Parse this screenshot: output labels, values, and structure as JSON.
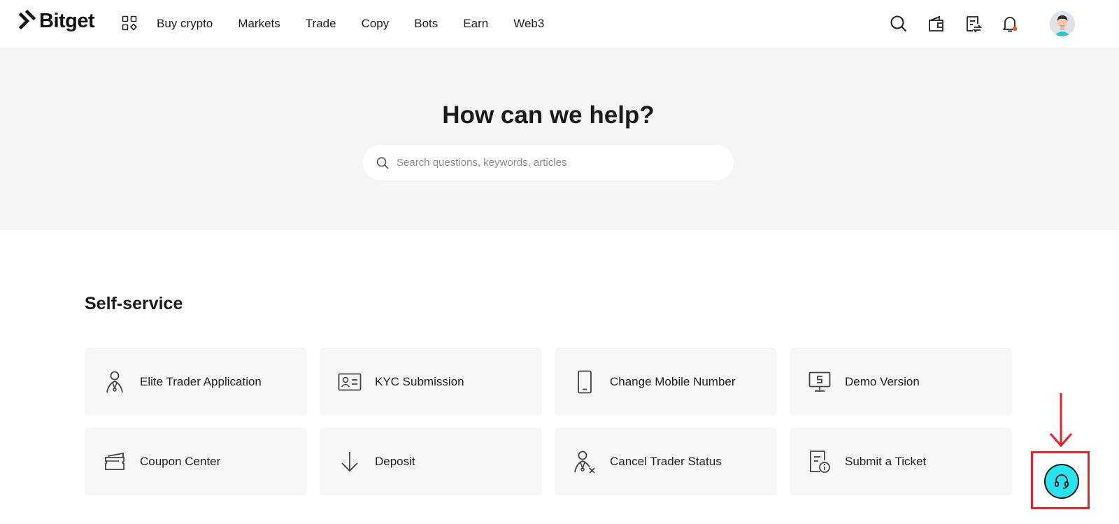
{
  "header": {
    "brand": "Bitget",
    "nav": [
      "Buy crypto",
      "Markets",
      "Trade",
      "Copy",
      "Bots",
      "Earn",
      "Web3"
    ],
    "icons": [
      "search-icon",
      "wallet-icon",
      "orders-icon",
      "bell-icon"
    ],
    "notification_dot_color": "#f05a28"
  },
  "hero": {
    "title": "How can we help?",
    "search_placeholder": "Search questions, keywords, articles"
  },
  "self_service": {
    "title": "Self-service",
    "cards": [
      {
        "label": "Elite Trader Application",
        "icon": "trader-icon"
      },
      {
        "label": "KYC Submission",
        "icon": "id-card-icon"
      },
      {
        "label": "Change Mobile Number",
        "icon": "mobile-icon"
      },
      {
        "label": "Demo Version",
        "icon": "demo-monitor-icon"
      },
      {
        "label": "Coupon Center",
        "icon": "coupon-icon"
      },
      {
        "label": "Deposit",
        "icon": "arrow-down-icon"
      },
      {
        "label": "Cancel Trader Status",
        "icon": "trader-cancel-icon"
      },
      {
        "label": "Submit a Ticket",
        "icon": "ticket-icon"
      }
    ]
  },
  "support": {
    "icon": "headset-icon",
    "button_color": "#27e3ef",
    "annotation_color": "#e0242b"
  }
}
